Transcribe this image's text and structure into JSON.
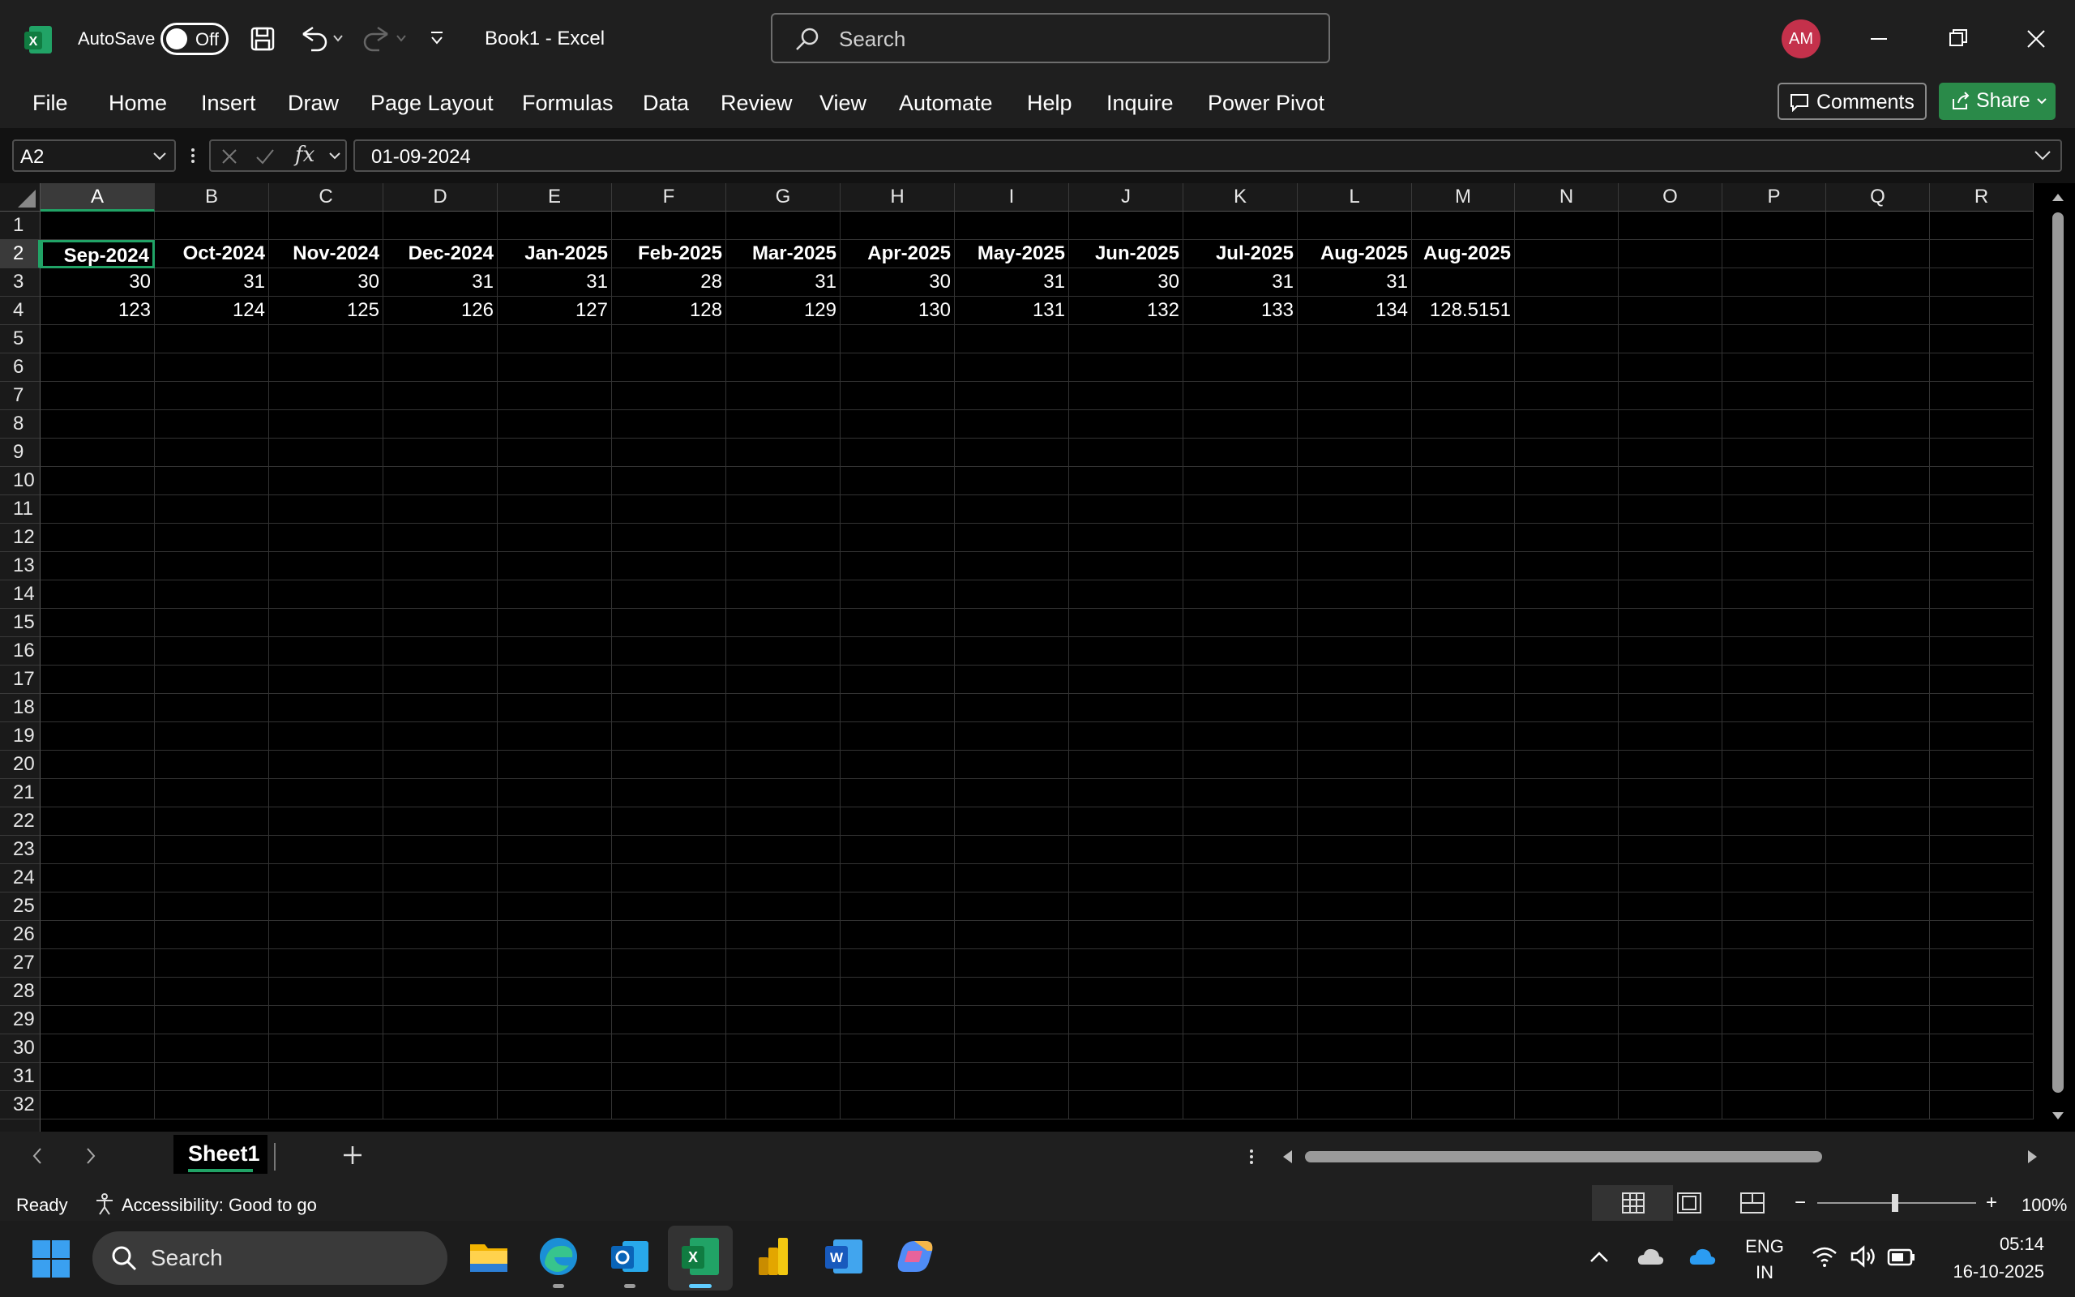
{
  "titlebar": {
    "autosave_label": "AutoSave",
    "autosave_state": "Off",
    "doc_title": "Book1  -  Excel",
    "search_placeholder": "Search",
    "avatar_initials": "AM"
  },
  "menu": [
    "File",
    "Home",
    "Insert",
    "Draw",
    "Page Layout",
    "Formulas",
    "Data",
    "Review",
    "View",
    "Automate",
    "Help",
    "Inquire",
    "Power Pivot"
  ],
  "ribbon_buttons": {
    "comments": "Comments",
    "share": "Share"
  },
  "formula_bar": {
    "name_box": "A2",
    "fx": "fx",
    "formula": "01-09-2024"
  },
  "sheet": {
    "columns": [
      "A",
      "B",
      "C",
      "D",
      "E",
      "F",
      "G",
      "H",
      "I",
      "J",
      "K",
      "L",
      "M",
      "N",
      "O",
      "P",
      "Q",
      "R"
    ],
    "rows": [
      "1",
      "2",
      "3",
      "4",
      "5",
      "6",
      "7",
      "8",
      "9",
      "10",
      "11",
      "12",
      "13",
      "14",
      "15",
      "16",
      "17",
      "18",
      "19",
      "20",
      "21",
      "22",
      "23",
      "24",
      "25",
      "26",
      "27",
      "28",
      "29",
      "30",
      "31",
      "32"
    ],
    "selected_cell": "A2",
    "data": [
      [],
      [
        "Sep-2024",
        "Oct-2024",
        "Nov-2024",
        "Dec-2024",
        "Jan-2025",
        "Feb-2025",
        "Mar-2025",
        "Apr-2025",
        "May-2025",
        "Jun-2025",
        "Jul-2025",
        "Aug-2025",
        "Aug-2025"
      ],
      [
        "30",
        "31",
        "30",
        "31",
        "31",
        "28",
        "31",
        "30",
        "31",
        "30",
        "31",
        "31",
        ""
      ],
      [
        "123",
        "124",
        "125",
        "126",
        "127",
        "128",
        "129",
        "130",
        "131",
        "132",
        "133",
        "134",
        "128.5151"
      ]
    ]
  },
  "tabs": {
    "sheet1": "Sheet1"
  },
  "status": {
    "ready": "Ready",
    "accessibility": "Accessibility: Good to go",
    "zoom": "100%"
  },
  "taskbar": {
    "search": "Search",
    "lang1": "ENG",
    "lang2": "IN",
    "time": "05:14",
    "date": "16-10-2025"
  },
  "colors": {
    "accent": "#21a366",
    "avatar": "#c4314b",
    "share": "#2a8a49"
  }
}
